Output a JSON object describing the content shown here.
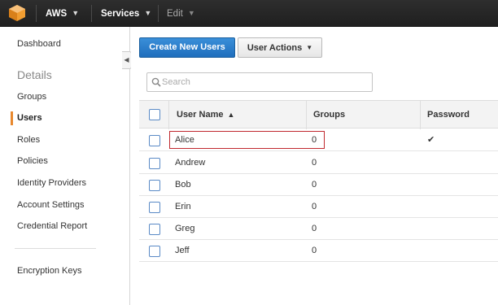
{
  "topbar": {
    "logo_icon": "aws-cube-icon",
    "aws_label": "AWS",
    "services_label": "Services",
    "edit_label": "Edit",
    "accent": "#f19d31"
  },
  "sidebar": {
    "dashboard": "Dashboard",
    "details_heading": "Details",
    "groups": "Groups",
    "users": "Users",
    "roles": "Roles",
    "policies": "Policies",
    "identity_providers": "Identity Providers",
    "account_settings": "Account Settings",
    "credential_report": "Credential Report",
    "encryption_keys": "Encryption Keys",
    "active_accent": "#e8882d"
  },
  "toolbar": {
    "create_label": "Create New Users",
    "actions_label": "User Actions"
  },
  "search": {
    "placeholder": "Search"
  },
  "table": {
    "columns": [
      "User Name",
      "Groups",
      "Password"
    ],
    "rows": [
      {
        "name": "Alice",
        "groups": "0",
        "password": "✔"
      },
      {
        "name": "Andrew",
        "groups": "0",
        "password": ""
      },
      {
        "name": "Bob",
        "groups": "0",
        "password": ""
      },
      {
        "name": "Erin",
        "groups": "0",
        "password": ""
      },
      {
        "name": "Greg",
        "groups": "0",
        "password": ""
      },
      {
        "name": "Jeff",
        "groups": "0",
        "password": ""
      }
    ],
    "highlight_color": "#c0282e"
  }
}
